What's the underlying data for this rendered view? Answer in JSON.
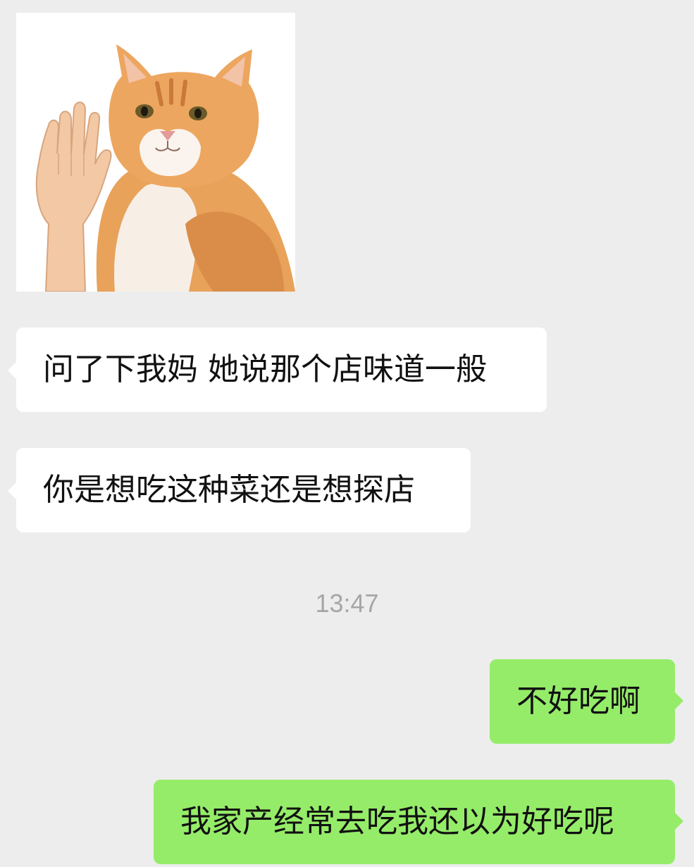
{
  "chat": {
    "sticker": {
      "icon": "cat-raising-hand-sticker"
    },
    "messages": [
      {
        "side": "incoming",
        "text": "问了下我妈 她说那个店味道一般"
      },
      {
        "side": "incoming",
        "text": "你是想吃这种菜还是想探店"
      },
      {
        "side": "outgoing",
        "text": "不好吃啊"
      },
      {
        "side": "outgoing",
        "text": "我家产经常去吃我还以为好吃呢"
      }
    ],
    "timestamp": "13:47"
  },
  "colors": {
    "background": "#ededed",
    "incoming_bubble": "#ffffff",
    "outgoing_bubble": "#95ec69",
    "timestamp_text": "#a6a6a6"
  }
}
